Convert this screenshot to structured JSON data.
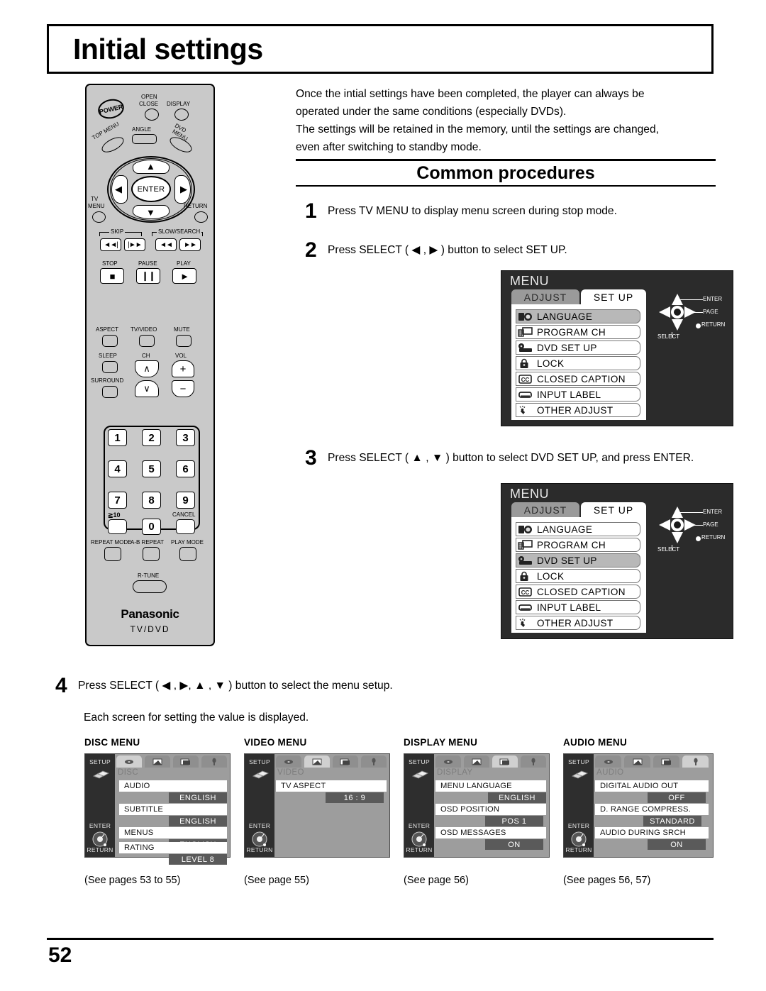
{
  "page": {
    "title": "Initial settings",
    "number": "52"
  },
  "intro": {
    "line1": "Once the intial settings have been completed, the player can always be",
    "line2": "operated under the same conditions (especially DVDs).",
    "line3": "The settings will be retained in the memory, until the settings are changed,",
    "line4": "even after switching to standby mode."
  },
  "section": {
    "heading": "Common procedures"
  },
  "steps": [
    {
      "num": "1",
      "text": "Press TV MENU to display menu screen during stop mode."
    },
    {
      "num": "2",
      "text": "Press SELECT ( ◀ , ▶ ) button to select SET UP."
    },
    {
      "num": "3",
      "text": "Press SELECT ( ▲ , ▼ ) button to select DVD SET UP, and press ENTER."
    },
    {
      "num": "4",
      "text": "Press SELECT ( ◀ , ▶, ▲ , ▼ ) button to select the menu setup."
    }
  ],
  "step4_note": "Each screen for setting the value is displayed.",
  "remote": {
    "power": "POWER",
    "open_close": "OPEN\nCLOSE",
    "open": "OPEN",
    "close": "CLOSE",
    "display": "DISPLAY",
    "top_menu": "TOP MENU",
    "angle": "ANGLE",
    "dvd_menu": "DVD\nMENU",
    "dvd": "DVD",
    "menu": "MENU",
    "enter": "ENTER",
    "tv_menu_1": "TV",
    "tv_menu_2": "MENU",
    "return": "RETURN",
    "skip": "SKIP",
    "slow_search": "SLOW/SEARCH",
    "stop": "STOP",
    "pause": "PAUSE",
    "play": "PLAY",
    "aspect": "ASPECT",
    "tv_video": "TV/VIDEO",
    "mute": "MUTE",
    "sleep": "SLEEP",
    "ch": "CH",
    "vol": "VOL",
    "surround": "SURROUND",
    "keys": [
      "1",
      "2",
      "3",
      "4",
      "5",
      "6",
      "7",
      "8",
      "9"
    ],
    "over10": "≧10",
    "zero": "0",
    "cancel": "CANCEL",
    "repeat_mode": "REPEAT MODE",
    "ab_repeat": "A-B REPEAT",
    "play_mode": "PLAY MODE",
    "r_tune": "R-TUNE",
    "brand": "Panasonic",
    "brand_sub": "TV/DVD",
    "skip_prev": "◄◄|",
    "skip_next": "|►►",
    "search_rev": "◄◄",
    "search_fwd": "►►",
    "stop_glyph": "■",
    "pause_glyph": "❙❙",
    "play_glyph": "►",
    "vol_plus": "+",
    "vol_minus": "−",
    "ch_up": "∧",
    "ch_down": "∨"
  },
  "osd_menus": [
    {
      "title": "MENU",
      "tab_inactive": "ADJUST",
      "tab_active": "SET UP",
      "selected": "LANGUAGE",
      "items": [
        {
          "label": "LANGUAGE",
          "icon": "language-icon"
        },
        {
          "label": "PROGRAM  CH",
          "icon": "program-ch-icon"
        },
        {
          "label": "DVD  SET  UP",
          "icon": "dvd-setup-icon"
        },
        {
          "label": "LOCK",
          "icon": "lock-icon"
        },
        {
          "label": "CLOSED CAPTION",
          "icon": "closed-caption-icon"
        },
        {
          "label": "INPUT  LABEL",
          "icon": "input-label-icon"
        },
        {
          "label": "OTHER  ADJUST",
          "icon": "other-adjust-icon"
        }
      ],
      "nav": {
        "enter": "ENTER",
        "page": "PAGE",
        "return": "RETURN",
        "select": "SELECT"
      }
    },
    {
      "title": "MENU",
      "tab_inactive": "ADJUST",
      "tab_active": "SET UP",
      "selected": "DVD  SET  UP",
      "items": [
        {
          "label": "LANGUAGE",
          "icon": "language-icon"
        },
        {
          "label": "PROGRAM  CH",
          "icon": "program-ch-icon"
        },
        {
          "label": "DVD  SET  UP",
          "icon": "dvd-setup-icon"
        },
        {
          "label": "LOCK",
          "icon": "lock-icon"
        },
        {
          "label": "CLOSED CAPTION",
          "icon": "closed-caption-icon"
        },
        {
          "label": "INPUT  LABEL",
          "icon": "input-label-icon"
        },
        {
          "label": "OTHER  ADJUST",
          "icon": "other-adjust-icon"
        }
      ],
      "nav": {
        "enter": "ENTER",
        "page": "PAGE",
        "return": "RETURN",
        "select": "SELECT"
      }
    }
  ],
  "setup_screens": [
    {
      "title": "DISC MENU",
      "sidebar": {
        "setup": "SETUP",
        "enter": "ENTER",
        "return": "RETURN"
      },
      "section_label": "DISC",
      "active_tab": 0,
      "tabs": [
        "disc-icon",
        "video-icon",
        "display-icon",
        "audio-icon"
      ],
      "rows": [
        {
          "label": "AUDIO",
          "value": "ENGLISH"
        },
        {
          "label": "SUBTITLE",
          "value": "ENGLISH"
        },
        {
          "label": "MENUS",
          "value": "ENGLISH"
        },
        {
          "label": "RATING",
          "value": "LEVEL 8"
        }
      ],
      "see": "(See pages 53 to 55)"
    },
    {
      "title": "VIDEO MENU",
      "sidebar": {
        "setup": "SETUP",
        "enter": "ENTER",
        "return": "RETURN"
      },
      "section_label": "VIDEO",
      "active_tab": 1,
      "tabs": [
        "disc-icon",
        "video-icon",
        "display-icon",
        "audio-icon"
      ],
      "rows": [
        {
          "label": "TV ASPECT",
          "value": "16 : 9"
        }
      ],
      "see": "(See page 55)"
    },
    {
      "title": "DISPLAY MENU",
      "sidebar": {
        "setup": "SETUP",
        "enter": "ENTER",
        "return": "RETURN"
      },
      "section_label": "DISPLAY",
      "active_tab": 2,
      "tabs": [
        "disc-icon",
        "video-icon",
        "display-icon",
        "audio-icon"
      ],
      "rows": [
        {
          "label": "MENU LANGUAGE",
          "value": "ENGLISH"
        },
        {
          "label": "OSD POSITION",
          "value": "POS  1"
        },
        {
          "label": "OSD MESSAGES",
          "value": "ON"
        }
      ],
      "see": "(See page 56)"
    },
    {
      "title": "AUDIO MENU",
      "sidebar": {
        "setup": "SETUP",
        "enter": "ENTER",
        "return": "RETURN"
      },
      "section_label": "AUDIO",
      "active_tab": 3,
      "tabs": [
        "disc-icon",
        "video-icon",
        "display-icon",
        "audio-icon"
      ],
      "rows": [
        {
          "label": "DIGITAL AUDIO OUT",
          "value": "OFF"
        },
        {
          "label": "D. RANGE COMPRESS.",
          "value": "STANDARD"
        },
        {
          "label": "AUDIO DURING SRCH",
          "value": "ON"
        }
      ],
      "see": "(See pages 56, 57)"
    }
  ]
}
